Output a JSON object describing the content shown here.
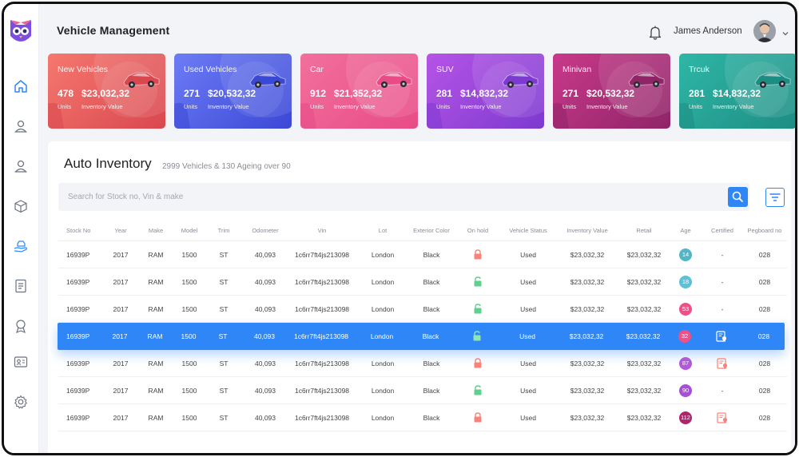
{
  "header": {
    "title": "Vehicle Management",
    "user_name": "James Anderson"
  },
  "cards": [
    {
      "title": "New Vehicles",
      "units": "478",
      "value": "$23,032,32",
      "units_label": "Units",
      "value_label": "Inventory Value",
      "color": "#f5786f",
      "accent": "#d9474f"
    },
    {
      "title": "Used Vehicles",
      "units": "271",
      "value": "$20,532,32",
      "units_label": "Units",
      "value_label": "Inventory Value",
      "color": "#6d7cf5",
      "accent": "#3a48d6"
    },
    {
      "title": "Car",
      "units": "912",
      "value": "$21,352,32",
      "units_label": "Units",
      "value_label": "Inventory Value",
      "color": "#f2709c",
      "accent": "#e84b86"
    },
    {
      "title": "SUV",
      "units": "281",
      "value": "$14,832,32",
      "units_label": "Units",
      "value_label": "Inventory Value",
      "color": "#b654e6",
      "accent": "#7d3ad0"
    },
    {
      "title": "Minivan",
      "units": "271",
      "value": "$20,532,32",
      "units_label": "Units",
      "value_label": "Inventory Value",
      "color": "#c9398a",
      "accent": "#8f2467"
    },
    {
      "title": "Trcuk",
      "units": "281",
      "value": "$14,832,32",
      "units_label": "Units",
      "value_label": "Inventory Value",
      "color": "#2fb7a6",
      "accent": "#1d8d84"
    }
  ],
  "inventory": {
    "title": "Auto Inventory",
    "subtitle": "2999 Vehicles & 130 Ageing over 90",
    "search_placeholder": "Search for Stock no, Vin & make"
  },
  "table": {
    "columns": [
      "Stock No",
      "Year",
      "Make",
      "Model",
      "Trim",
      "Odometer",
      "Vin",
      "Lot",
      "Exterior Color",
      "On hold",
      "Vehicle Status",
      "Inventory Value",
      "Retail",
      "Age",
      "Certified",
      "Pegboard no"
    ],
    "rows": [
      {
        "stock": "16939P",
        "year": "2017",
        "make": "RAM",
        "model": "1500",
        "trim": "ST",
        "odometer": "40,093",
        "vin": "1c6rr7ft4js213098",
        "lot": "London",
        "color": "Black",
        "on_hold": "locked",
        "status": "Used",
        "inv_value": "$23,032,32",
        "retail": "$23,032,32",
        "age": "14",
        "age_color": "#52b6c6",
        "certified": "-",
        "pegboard": "028"
      },
      {
        "stock": "16939P",
        "year": "2017",
        "make": "RAM",
        "model": "1500",
        "trim": "ST",
        "odometer": "40,093",
        "vin": "1c6rr7ft4js213098",
        "lot": "London",
        "color": "Black",
        "on_hold": "unlocked",
        "status": "Used",
        "inv_value": "$23,032,32",
        "retail": "$23,032,32",
        "age": "18",
        "age_color": "#5cc0d9",
        "certified": "-",
        "pegboard": "028"
      },
      {
        "stock": "16939P",
        "year": "2017",
        "make": "RAM",
        "model": "1500",
        "trim": "ST",
        "odometer": "40,093",
        "vin": "1c6rr7ft4js213098",
        "lot": "London",
        "color": "Black",
        "on_hold": "unlocked",
        "status": "Used",
        "inv_value": "$23,032,32",
        "retail": "$23,032,32",
        "age": "53",
        "age_color": "#f24e8a",
        "certified": "-",
        "pegboard": "028"
      },
      {
        "stock": "16939P",
        "year": "2017",
        "make": "RAM",
        "model": "1500",
        "trim": "ST",
        "odometer": "40,093",
        "vin": "1c6rr7ft4js213098",
        "lot": "London",
        "color": "Black",
        "on_hold": "unlocked",
        "status": "Used",
        "inv_value": "$23,032,32",
        "retail": "$23,032,32",
        "age": "32",
        "age_color": "#f24e8a",
        "certified": "icon",
        "pegboard": "028"
      },
      {
        "stock": "16939P",
        "year": "2017",
        "make": "RAM",
        "model": "1500",
        "trim": "ST",
        "odometer": "40,093",
        "vin": "1c6rr7ft4js213098",
        "lot": "London",
        "color": "Black",
        "on_hold": "locked",
        "status": "Used",
        "inv_value": "$23,032,32",
        "retail": "$23,032,32",
        "age": "87",
        "age_color": "#b05ad8",
        "certified": "icon",
        "pegboard": "028"
      },
      {
        "stock": "16939P",
        "year": "2017",
        "make": "RAM",
        "model": "1500",
        "trim": "ST",
        "odometer": "40,093",
        "vin": "1c6rr7ft4js213098",
        "lot": "London",
        "color": "Black",
        "on_hold": "unlocked",
        "status": "Used",
        "inv_value": "$23,032,32",
        "retail": "$23,032,32",
        "age": "90",
        "age_color": "#a64fd6",
        "certified": "-",
        "pegboard": "028"
      },
      {
        "stock": "16939P",
        "year": "2017",
        "make": "RAM",
        "model": "1500",
        "trim": "ST",
        "odometer": "40,093",
        "vin": "1c6rr7ft4js213098",
        "lot": "London",
        "color": "Black",
        "on_hold": "locked",
        "status": "Used",
        "inv_value": "$23,032,32",
        "retail": "$23,032,32",
        "age": "112",
        "age_color": "#b0246e",
        "certified": "icon",
        "pegboard": "028"
      }
    ],
    "selected_row": 3
  },
  "sidebar": {
    "items": [
      "home-icon",
      "user-icon",
      "user-alt-icon",
      "package-icon",
      "hand-car-icon",
      "document-icon",
      "award-icon",
      "id-card-icon",
      "gear-icon"
    ],
    "active": "home-icon"
  },
  "colors": {
    "primary": "#2f86f6",
    "locked": "#f7837a",
    "unlocked": "#5fd08e",
    "sidebar_icon": "#6b7280",
    "sidebar_active": "#2f86f6"
  }
}
